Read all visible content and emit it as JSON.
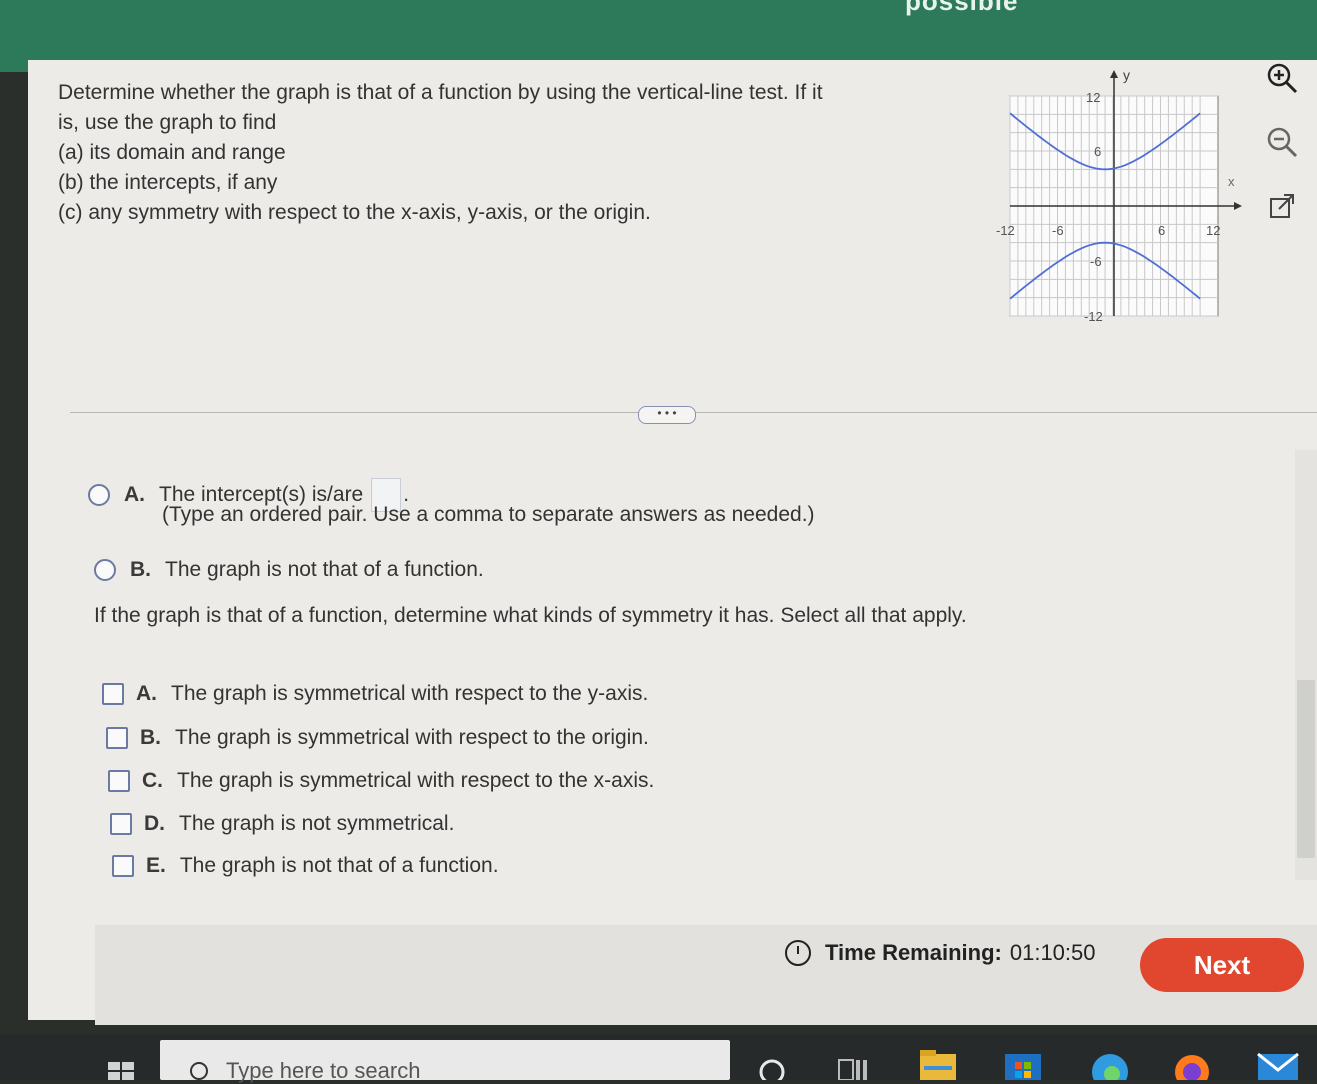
{
  "header": {
    "partial_title": "possible"
  },
  "prompt": {
    "line1": "Determine whether the graph is that of a function by using the vertical-line test.  If it",
    "line2": "is, use the graph to find",
    "line3": "(a)  its domain and range",
    "line4": "(b)  the intercepts, if any",
    "line5": "(c)  any symmetry with respect to the x-axis, y-axis, or the origin."
  },
  "graph": {
    "y_axis_label": "y",
    "x_axis_label": "x",
    "ticks": {
      "y_top": "12",
      "y_6": "6",
      "y_neg6": "-6",
      "y_bottom": "-12",
      "x_neg12": "-12",
      "x_neg6": "-6",
      "x_6": "6",
      "x_12": "12"
    },
    "curve_color": "#4f6fd6",
    "x_range": [
      -12,
      12
    ],
    "y_range": [
      -12,
      12
    ],
    "upper_curve_vertex": [
      0,
      4
    ],
    "lower_curve_vertex": [
      0,
      -4
    ]
  },
  "tools": {
    "zoom_in": "zoom-in-icon",
    "zoom_out": "zoom-out-icon",
    "popout": "popout-icon"
  },
  "expand_label": "• • •",
  "part_b": {
    "option_a_letter": "A.",
    "option_a_text": "The intercept(s) is/are",
    "option_a_hint": "(Type an ordered pair. Use a comma to separate answers as needed.)",
    "option_b_letter": "B.",
    "option_b_text": "The graph is not that of a function."
  },
  "part_c": {
    "question": "If the graph is that of a function, determine what kinds of symmetry it has. Select all that apply.",
    "options": [
      {
        "letter": "A.",
        "text": "The graph is symmetrical with respect to the y-axis."
      },
      {
        "letter": "B.",
        "text": "The graph is symmetrical with respect to the origin."
      },
      {
        "letter": "C.",
        "text": "The graph is symmetrical with respect to the x-axis."
      },
      {
        "letter": "D.",
        "text": "The graph is not symmetrical."
      },
      {
        "letter": "E.",
        "text": "The graph is not that of a function."
      }
    ]
  },
  "footer": {
    "timer_label": "Time Remaining:",
    "timer_value": "01:10:50",
    "next_label": "Next"
  },
  "taskbar": {
    "search_placeholder": "Type here to search"
  }
}
